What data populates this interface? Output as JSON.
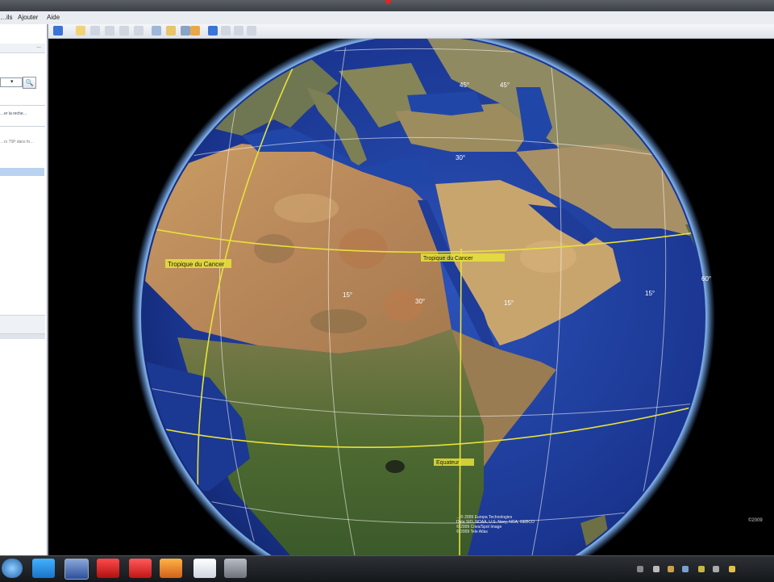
{
  "window": {
    "menus": [
      "…ils",
      "Ajouter",
      "Aide"
    ]
  },
  "sidebar": {
    "tab_label": "…",
    "search_button": "🔍",
    "link_text": "…er la reche…",
    "info_text": "…rs 75P dans fo…"
  },
  "map": {
    "equator_label": "Equateur",
    "tropic_cancer_label": "Tropique du Cancer",
    "tropic_cancer_west_label": "Tropique du Cancer",
    "grid_labels": [
      "45°",
      "30°",
      "15°",
      "30°",
      "15°",
      "15°",
      "45°",
      "60°"
    ],
    "copyright": "©2009",
    "imagery_lines": [
      "…© 2009 Europa Technologies",
      "Data SIO, NOAA, U.S. Navy, NGA, GEBCO",
      "© 2009 Cnes/Spot Image",
      "© 2009 Tele Atlas"
    ]
  },
  "colors": {
    "grid": "#e8e23a",
    "ocean": "#1f3f9e",
    "atmosphere": "#6aa9ff",
    "desert": "#b88e5c",
    "vegetation": "#4f6a32"
  },
  "taskbar": {
    "apps": [
      "start",
      "skype",
      "google-earth",
      "media-player",
      "recorder",
      "firefox",
      "document",
      "security"
    ]
  }
}
